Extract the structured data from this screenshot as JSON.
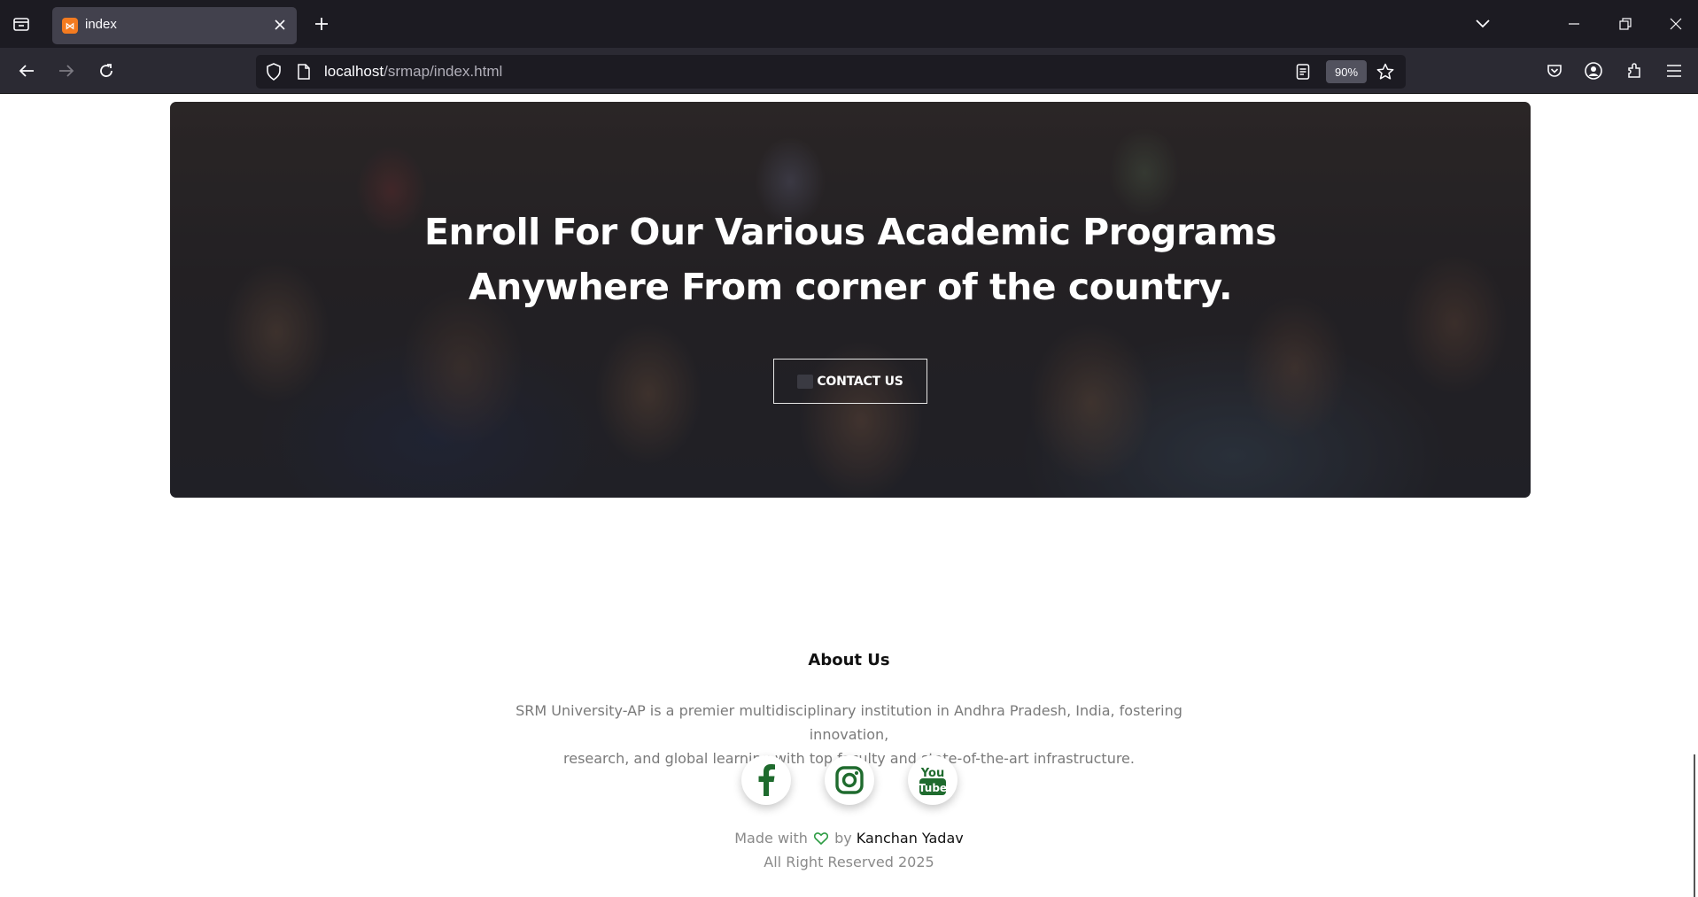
{
  "browser": {
    "tab_title": "index",
    "url_host": "localhost",
    "url_path": "/srmap/index.html",
    "zoom": "90%",
    "colors": {
      "chrome": "#1c1b22",
      "toolbar": "#2b2a33",
      "tab_active": "#42414d"
    }
  },
  "hero": {
    "title_line1": "Enroll For Our Various Academic Programs",
    "title_line2": "Anywhere From corner of the country.",
    "contact_button": "CONTACT US"
  },
  "about": {
    "title": "About Us",
    "text_line1": "SRM University-AP is a premier multidisciplinary institution in Andhra Pradesh, India, fostering innovation,",
    "text_line2": "research, and global learning with top faculty and state-of-the-art infrastructure."
  },
  "social": {
    "icons": [
      "facebook-icon",
      "instagram-icon",
      "youtube-icon"
    ],
    "accent": "#1f6b2e"
  },
  "footer": {
    "made_with": "Made with",
    "by": "by",
    "author": "Kanchan Yadav",
    "rights": "All Right Reserved 2025"
  }
}
